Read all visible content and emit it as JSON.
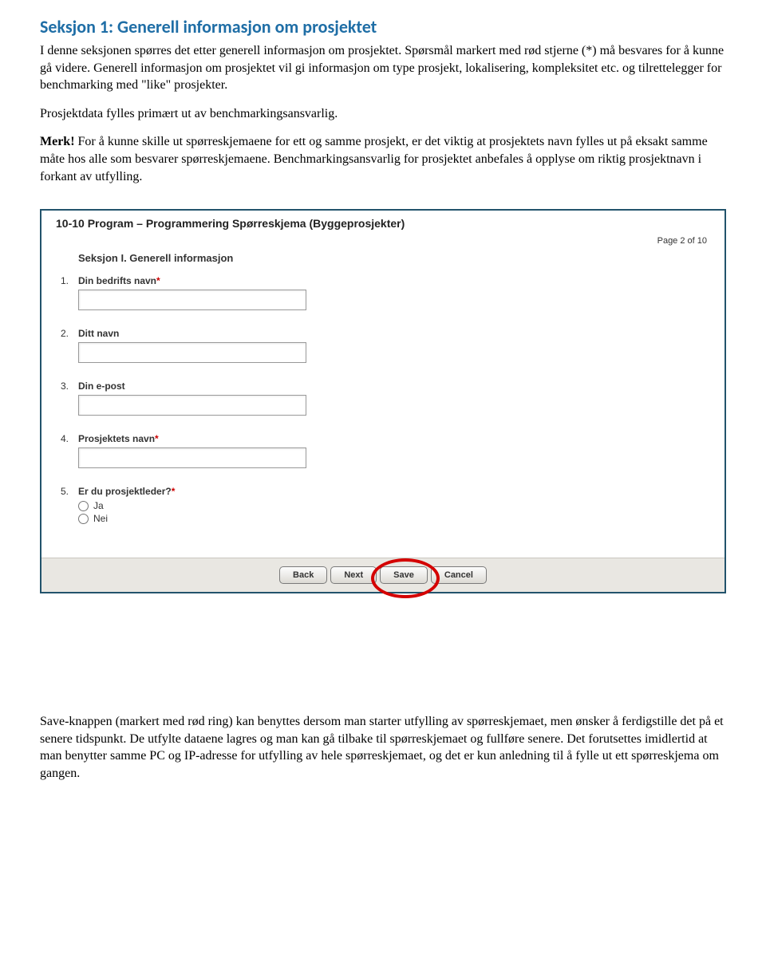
{
  "section": {
    "heading": "Seksjon 1: Generell informasjon om prosjektet",
    "p1": "I denne seksjonen spørres det etter generell informasjon om prosjektet. Spørsmål markert med rød stjerne (*) må besvares for å kunne gå videre. Generell informasjon om prosjektet vil gi informasjon om type prosjekt, lokalisering, kompleksitet etc. og tilrettelegger for benchmarking med \"like\" prosjekter.",
    "p2": "Prosjektdata fylles primært ut av benchmarkingsansvarlig.",
    "merk_label": "Merk!",
    "merk_text": " For å kunne skille ut spørreskjemaene for ett og samme prosjekt, er det viktig at prosjektets navn fylles ut på eksakt samme måte hos alle som besvarer spørreskjemaene. Benchmarkingsansvarlig for prosjektet anbefales å opplyse om riktig prosjektnavn i forkant av utfylling."
  },
  "form": {
    "title": "10-10 Program – Programmering Spørreskjema (Byggeprosjekter)",
    "page_indicator": "Page 2 of 10",
    "section_title": "Seksjon I. Generell informasjon",
    "questions": {
      "q1": {
        "num": "1.",
        "label": "Din bedrifts navn",
        "required": true
      },
      "q2": {
        "num": "2.",
        "label": "Ditt navn",
        "required": false
      },
      "q3": {
        "num": "3.",
        "label": "Din e-post",
        "required": false
      },
      "q4": {
        "num": "4.",
        "label": "Prosjektets navn",
        "required": true
      },
      "q5": {
        "num": "5.",
        "label": "Er du prosjektleder?",
        "required": true,
        "opt1": "Ja",
        "opt2": "Nei"
      }
    },
    "buttons": {
      "back": "Back",
      "next": "Next",
      "save": "Save",
      "cancel": "Cancel"
    }
  },
  "footer": {
    "text": "Save-knappen (markert med rød ring) kan benyttes dersom man starter utfylling av spørreskjemaet, men ønsker å ferdigstille det på et senere tidspunkt. De utfylte dataene lagres og man kan gå tilbake til spørreskjemaet og fullføre senere. Det forutsettes imidlertid at man benytter samme PC og IP-adresse for utfylling av hele spørreskjemaet, og det er kun anledning til å fylle ut ett spørreskjema om gangen."
  }
}
